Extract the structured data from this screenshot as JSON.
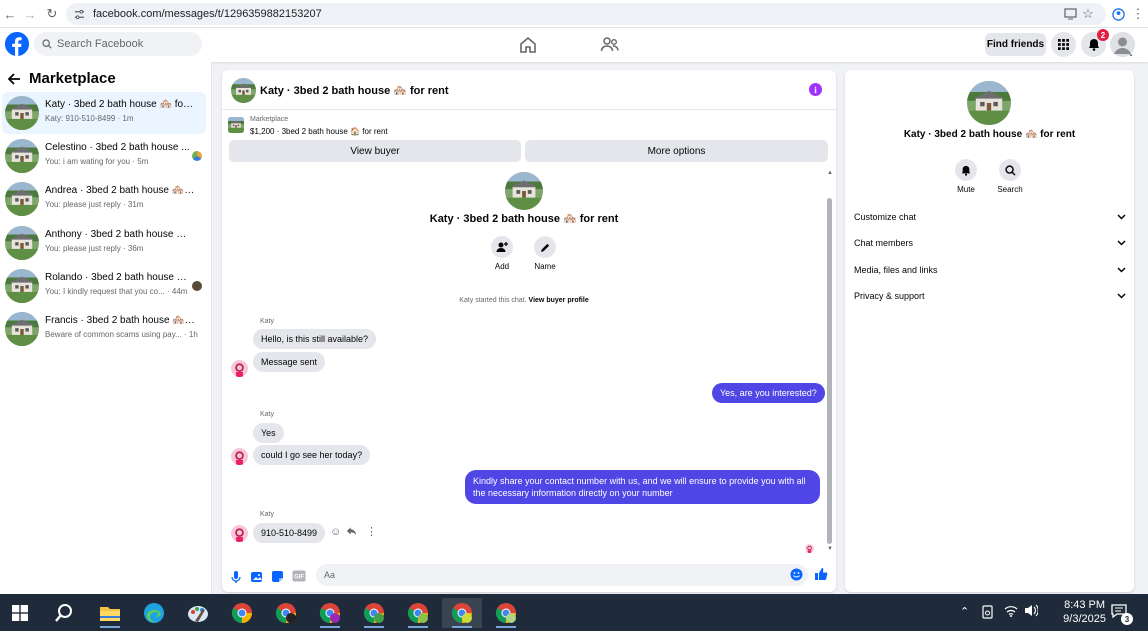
{
  "browser": {
    "url": "facebook.com/messages/t/1296359882153207"
  },
  "header": {
    "search_placeholder": "Search Facebook",
    "find_friends": "Find friends",
    "notification_count": "2"
  },
  "sidebar": {
    "title": "Marketplace",
    "conversations": [
      {
        "name": "Katy · 3bed 2 bath house 🏘️ for rent",
        "preview": "Katy: 910-510-8499 · 1m",
        "active": true
      },
      {
        "name": "Celestino · 3bed 2 bath house ...",
        "preview": "You: i am wating for you · 5m"
      },
      {
        "name": "Andrea · 3bed 2 bath house 🏘️ for...",
        "preview": "You: please just reply · 31m"
      },
      {
        "name": "Anthony · 3bed 2 bath house 🏘️ f...",
        "preview": "You: please just reply · 36m"
      },
      {
        "name": "Rolando · 3bed 2 bath house 🏘️ ...",
        "preview": "You: I kindly request that you co... · 44m"
      },
      {
        "name": "Francis · 3bed 2 bath house 🏘️ for...",
        "preview": "Beware of common scams using pay... · 1h"
      }
    ]
  },
  "chat": {
    "title": "Katy · 3bed 2 bath house 🏘️ for rent",
    "listing_label": "Marketplace",
    "listing_sub": "$1,200 · 3bed 2 bath house 🏠 for rent",
    "view_buyer": "View buyer",
    "more_options": "More options",
    "intro_title": "Katy · 3bed 2 bath house 🏘️ for rent",
    "intro_add": "Add",
    "intro_name": "Name",
    "started_text": "Katy started this chat.",
    "view_buyer_profile": "View buyer profile",
    "messages": {
      "sender1": "Katy",
      "m1": "Hello, is this still available?",
      "m2": "Message sent",
      "m3": "Yes, are you interested?",
      "sender2": "Katy",
      "m4": "Yes",
      "m5": "could I go see her today?",
      "m6": "Kindly share your contact number with us, and we will ensure to provide you with all the necessary information directly on your number",
      "sender3": "Katy",
      "m7": "910-510-8499"
    },
    "input_placeholder": "Aa"
  },
  "right": {
    "title": "Katy · 3bed 2 bath house 🏘️ for rent",
    "mute": "Mute",
    "search": "Search",
    "sections": [
      "Customize chat",
      "Chat members",
      "Media, files and links",
      "Privacy & support"
    ]
  },
  "taskbar": {
    "time": "8:43 PM",
    "date": "9/3/2025",
    "notif_count": "3"
  },
  "colors": {
    "brand": "#0866ff",
    "bubble_out": "#4f46e5",
    "info": "#a033ff"
  }
}
